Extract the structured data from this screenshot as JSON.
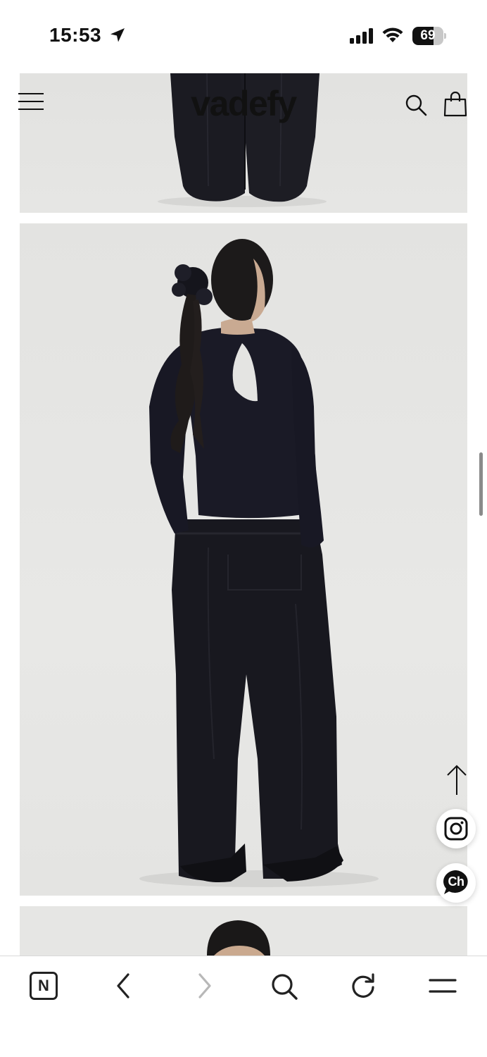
{
  "status_bar": {
    "time": "15:53",
    "battery_level": "69",
    "battery_fraction": 0.69
  },
  "header": {
    "brand": "vadefy",
    "icons": [
      "menu-icon",
      "search-icon",
      "shopping-bag-icon"
    ]
  },
  "floating_actions": {
    "icons": [
      "arrow-up-icon",
      "instagram-icon",
      "channel-talk-icon"
    ],
    "chat_label": "Ch"
  },
  "browser_toolbar": {
    "n_label": "N",
    "icons": [
      "naver-icon",
      "back-icon",
      "forward-icon",
      "search-icon",
      "reload-icon",
      "menu-icon"
    ],
    "forward_disabled": true
  },
  "colors": {
    "photo_background": "#e6e6e4",
    "garment": "#16161e",
    "accent": "#111111"
  }
}
